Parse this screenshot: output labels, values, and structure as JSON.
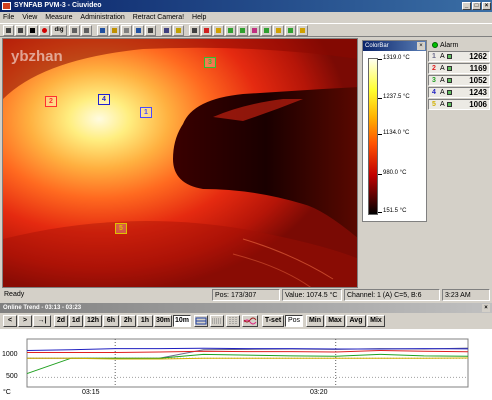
{
  "window": {
    "title": "SYNFAB PVM-3 - Ciuvideo",
    "btn_min": "_",
    "btn_max": "□",
    "btn_close": "×"
  },
  "menu": [
    "File",
    "View",
    "Measure",
    "Administration",
    "Retract Camera!",
    "Help"
  ],
  "toolbar": {
    "dig_label": "dig",
    "icons": [
      "arrow-icon",
      "play-icon",
      "stop-icon",
      "record-icon",
      "dig-button",
      "grid-icon",
      "grid2-icon",
      "save-icon",
      "lock-icon",
      "open-icon",
      "save2-icon",
      "snapshot-icon",
      "monitor-icon",
      "help-icon",
      "move-icon",
      "cross-icon",
      "folder-icon",
      "folder-open-icon",
      "save3-icon",
      "chart-icon",
      "export-icon",
      "folder2-icon",
      "export2-icon",
      "folder3-icon"
    ]
  },
  "image": {
    "watermark": "ybzhan",
    "hotspots": [
      {
        "id": "1",
        "color": "#4a4aff"
      },
      {
        "id": "2",
        "color": "#ff3030"
      },
      {
        "id": "3",
        "color": "#30c030"
      },
      {
        "id": "4",
        "color": "#2020d0"
      },
      {
        "id": "5",
        "color": "#e0c000"
      }
    ]
  },
  "colorbar": {
    "title": "ColorBar",
    "close": "×",
    "labels": [
      "1319.0 °C",
      "1237.5 °C",
      "1134.0 °C",
      "980.0 °C",
      "151.5 °C"
    ]
  },
  "alarm": {
    "title": "Alarm",
    "rows": [
      {
        "num": "1",
        "mode": "A",
        "value": "1262",
        "color": "#6a6a8a"
      },
      {
        "num": "2",
        "mode": "A",
        "value": "1169",
        "color": "#e02020"
      },
      {
        "num": "3",
        "mode": "A",
        "value": "1052",
        "color": "#20a020"
      },
      {
        "num": "4",
        "mode": "A",
        "value": "1243",
        "color": "#2020c0"
      },
      {
        "num": "5",
        "mode": "A",
        "value": "1006",
        "color": "#d0b000"
      }
    ]
  },
  "status": {
    "ready": "Ready",
    "pos": "Pos: 173/307",
    "value": "Value: 1074.5 °C",
    "channel": "Channel: 1 (A) C=5, B:6",
    "time": "3:23 AM"
  },
  "trend": {
    "title": "Online Trend - 03:13 - 03:23",
    "close": "×",
    "nav": [
      "<",
      ">",
      "→|"
    ],
    "ranges": [
      "2d",
      "1d",
      "12h",
      "6h",
      "2h",
      "1h",
      "30m",
      "10m"
    ],
    "selected_range": "10m",
    "tset": "T-set",
    "pos": "Pos",
    "stats": [
      "Min",
      "Max",
      "Avg",
      "Mix"
    ],
    "unit": "°C",
    "y_ticks": [
      "1000",
      "500"
    ],
    "x_ticks": [
      "03:15",
      "03:20"
    ]
  },
  "chart_data": {
    "type": "line",
    "x": [
      "03:13",
      "03:14",
      "03:15",
      "03:16",
      "03:17",
      "03:18",
      "03:19",
      "03:20",
      "03:21",
      "03:22",
      "03:23"
    ],
    "series": [
      {
        "name": "1",
        "color": "#6a6a8a",
        "values": [
          1000,
          1000,
          1000,
          1000,
          1220,
          1230,
          1240,
          1230,
          1250,
          1240,
          1262
        ]
      },
      {
        "name": "2",
        "color": "#e02020",
        "values": [
          1150,
          1150,
          1150,
          1160,
          1180,
          1170,
          1170,
          1160,
          1200,
          1180,
          1169
        ]
      },
      {
        "name": "3",
        "color": "#20a020",
        "values": [
          600,
          1000,
          1000,
          1000,
          1100,
          1080,
          1060,
          1050,
          1100,
          1060,
          1052
        ]
      },
      {
        "name": "4",
        "color": "#2020c0",
        "values": [
          1200,
          1220,
          1250,
          1250,
          1260,
          1250,
          1250,
          1240,
          1240,
          1250,
          1243
        ]
      },
      {
        "name": "5",
        "color": "#d0b000",
        "values": [
          1000,
          1000,
          980,
          980,
          1000,
          1000,
          1000,
          1000,
          1000,
          1000,
          1006
        ]
      }
    ],
    "ylim": [
      250,
      1500
    ],
    "grid": true
  }
}
